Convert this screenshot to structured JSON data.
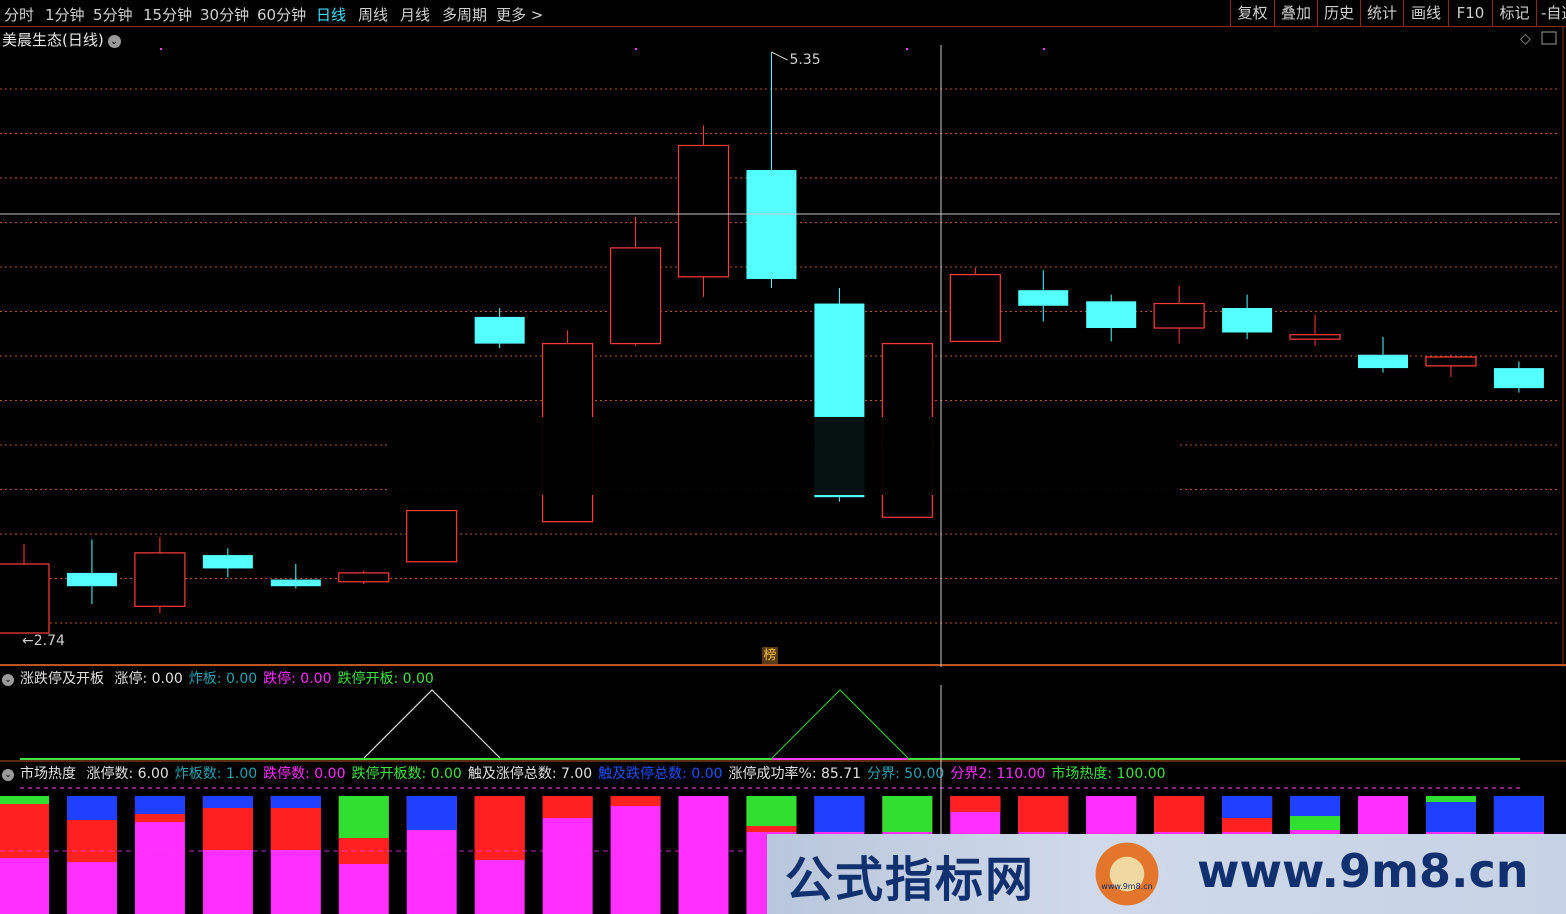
{
  "toolbar": {
    "periods": [
      "分时",
      "1分钟",
      "5分钟",
      "15分钟",
      "30分钟",
      "60分钟",
      "日线",
      "周线",
      "月线",
      "多周期",
      "更多 >"
    ],
    "active_period": "日线",
    "tools": [
      "复权",
      "叠加",
      "历史",
      "统计",
      "画线",
      "F10",
      "标记",
      "-自选"
    ]
  },
  "main_chart": {
    "title": "美晨生态(日线)",
    "max_label": "5.35",
    "min_label": "2.74",
    "marker_label": "榜",
    "colors": {
      "up": "#ff3c3c",
      "down": "#54ffff",
      "grid": "#b8561e",
      "bg": "#000000"
    }
  },
  "indicator1": {
    "name": "涨跌停及开板",
    "items": [
      {
        "label": "涨停: 0.00",
        "color": "#e0e0e0"
      },
      {
        "label": "炸板: 0.00",
        "color": "#2aa0b0"
      },
      {
        "label": "跌停: 0.00",
        "color": "#ff30ff"
      },
      {
        "label": "跌停开板: 0.00",
        "color": "#40e040"
      }
    ]
  },
  "indicator2": {
    "name": "市场热度",
    "items": [
      {
        "label": "涨停数: 6.00",
        "color": "#e0e0e0"
      },
      {
        "label": "炸板数: 1.00",
        "color": "#2aa0b0"
      },
      {
        "label": "跌停数: 0.00",
        "color": "#ff30ff"
      },
      {
        "label": "跌停开板数: 0.00",
        "color": "#40e040"
      },
      {
        "label": "触及涨停总数: 7.00",
        "color": "#e0e0e0"
      },
      {
        "label": "触及跌停总数: 0.00",
        "color": "#2050ff"
      },
      {
        "label": "涨停成功率%: 85.71",
        "color": "#e0e0e0"
      },
      {
        "label": "分界: 50.00",
        "color": "#2aa0b0"
      },
      {
        "label": "分界2: 110.00",
        "color": "#ff30ff"
      },
      {
        "label": "市场热度: 100.00",
        "color": "#40e040"
      }
    ]
  },
  "chart_data": {
    "type": "candlestick",
    "title": "美晨生态(日线)",
    "price_range": [
      2.74,
      5.35
    ],
    "candles": [
      {
        "o": 3.05,
        "c": 2.74,
        "h": 3.14,
        "l": 2.74,
        "dir": "up"
      },
      {
        "o": 3.01,
        "c": 2.95,
        "h": 3.16,
        "l": 2.87,
        "dir": "down"
      },
      {
        "o": 2.86,
        "c": 3.1,
        "h": 3.17,
        "l": 2.83,
        "dir": "up"
      },
      {
        "o": 3.09,
        "c": 3.03,
        "h": 3.12,
        "l": 2.99,
        "dir": "down"
      },
      {
        "o": 2.98,
        "c": 2.95,
        "h": 3.05,
        "l": 2.94,
        "dir": "down"
      },
      {
        "o": 2.97,
        "c": 3.01,
        "h": 3.02,
        "l": 2.96,
        "dir": "up"
      },
      {
        "o": 3.06,
        "c": 3.29,
        "h": 3.29,
        "l": 3.06,
        "dir": "up"
      },
      {
        "o": 4.16,
        "c": 4.04,
        "h": 4.2,
        "l": 4.02,
        "dir": "down"
      },
      {
        "o": 3.24,
        "c": 4.04,
        "h": 4.1,
        "l": 3.24,
        "dir": "up"
      },
      {
        "o": 4.04,
        "c": 4.47,
        "h": 4.61,
        "l": 4.03,
        "dir": "up"
      },
      {
        "o": 4.34,
        "c": 4.93,
        "h": 5.02,
        "l": 4.25,
        "dir": "up"
      },
      {
        "o": 4.82,
        "c": 4.33,
        "h": 5.35,
        "l": 4.29,
        "dir": "down"
      },
      {
        "o": 4.22,
        "c": 3.35,
        "h": 4.29,
        "l": 3.33,
        "dir": "down"
      },
      {
        "o": 3.26,
        "c": 4.04,
        "h": 4.04,
        "l": 3.26,
        "dir": "up"
      },
      {
        "o": 4.05,
        "c": 4.35,
        "h": 4.38,
        "l": 4.05,
        "dir": "up"
      },
      {
        "o": 4.28,
        "c": 4.21,
        "h": 4.37,
        "l": 4.14,
        "dir": "down"
      },
      {
        "o": 4.23,
        "c": 4.11,
        "h": 4.26,
        "l": 4.05,
        "dir": "down"
      },
      {
        "o": 4.11,
        "c": 4.22,
        "h": 4.3,
        "l": 4.04,
        "dir": "up"
      },
      {
        "o": 4.2,
        "c": 4.09,
        "h": 4.26,
        "l": 4.06,
        "dir": "down"
      },
      {
        "o": 4.06,
        "c": 4.08,
        "h": 4.17,
        "l": 4.03,
        "dir": "up"
      },
      {
        "o": 3.99,
        "c": 3.93,
        "h": 4.07,
        "l": 3.91,
        "dir": "down"
      },
      {
        "o": 3.94,
        "c": 3.98,
        "h": 3.99,
        "l": 3.89,
        "dir": "up"
      },
      {
        "o": 3.93,
        "c": 3.84,
        "h": 3.96,
        "l": 3.82,
        "dir": "down"
      }
    ]
  },
  "watermark": {
    "left_text": "公式指标网",
    "right_text": "www.9m8.cn",
    "logo_text": "www.9m8.cn"
  }
}
